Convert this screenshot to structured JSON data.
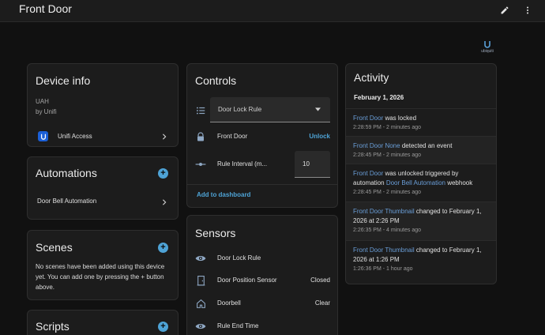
{
  "header": {
    "title": "Front Door",
    "edit_icon": "pencil-icon",
    "menu_icon": "more-vertical-icon"
  },
  "logo": {
    "text": "ubiquiti",
    "icon": "ubiquiti-logo"
  },
  "device_info": {
    "title": "Device info",
    "model": "UAH",
    "manufacturer": "by Unifi",
    "integration": "Unifi Access",
    "integration_icon": "unifi-access-icon"
  },
  "automations": {
    "title": "Automations",
    "items": [
      {
        "label": "Door Bell Automation"
      }
    ]
  },
  "scenes": {
    "title": "Scenes",
    "empty_text": "No scenes have been added using this device yet. You can add one by pressing the + button above."
  },
  "scripts": {
    "title": "Scripts"
  },
  "controls": {
    "title": "Controls",
    "select": {
      "icon": "format-list-bulleted-icon",
      "value": "Door Lock Rule"
    },
    "lock": {
      "icon": "lock-icon",
      "label": "Front Door",
      "action": "Unlock"
    },
    "interval": {
      "icon": "ray-vertex-icon",
      "label": "Rule Interval (m...",
      "value": "10"
    },
    "add_to_dashboard": "Add to dashboard"
  },
  "sensors": {
    "title": "Sensors",
    "rows": [
      {
        "icon": "eye-icon",
        "label": "Door Lock Rule",
        "value": ""
      },
      {
        "icon": "door-icon",
        "label": "Door Position Sensor",
        "value": "Closed"
      },
      {
        "icon": "home-icon",
        "label": "Doorbell",
        "value": "Clear"
      },
      {
        "icon": "eye-icon",
        "label": "Rule End Time",
        "value": ""
      }
    ]
  },
  "activity": {
    "title": "Activity",
    "date": "February 1, 2026",
    "items": [
      {
        "entity": "Front Door",
        "text": " was locked",
        "entity2": "",
        "text2": "",
        "time": "2:28:59 PM - 2 minutes ago"
      },
      {
        "entity": "Front Door None",
        "text": " detected an event",
        "entity2": "",
        "text2": "",
        "time": "2:28:45 PM - 2 minutes ago"
      },
      {
        "entity": "Front Door",
        "text": " was unlocked triggered by automation ",
        "entity2": "Door Bell Automation",
        "text2": " webhook",
        "time": "2:28:45 PM - 2 minutes ago"
      },
      {
        "entity": "Front Door Thumbnail",
        "text": " changed to February 1, 2026 at 2:26 PM",
        "entity2": "",
        "text2": "",
        "time": "2:26:35 PM - 4 minutes ago"
      },
      {
        "entity": "Front Door Thumbnail",
        "text": " changed to February 1, 2026 at 1:26 PM",
        "entity2": "",
        "text2": "",
        "time": "1:26:36 PM - 1 hour ago"
      }
    ]
  },
  "colors": {
    "accent": "#4ea3d6",
    "link": "#6a9ed8",
    "card_bg": "#1c1c1c",
    "page_bg": "#111111",
    "icon": "#8fa8c4"
  }
}
